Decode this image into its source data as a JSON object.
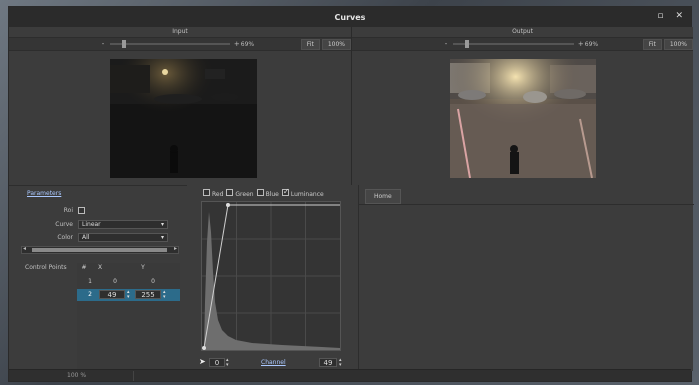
{
  "window": {
    "title": "Curves"
  },
  "input": {
    "header": "Input",
    "zoom_minus": "-",
    "zoom_plus": "+",
    "zoom_value": "69%",
    "fit_label": "Fit",
    "hundred_label": "100%"
  },
  "output": {
    "header": "Output",
    "zoom_minus": "-",
    "zoom_plus": "+",
    "zoom_value": "69%",
    "fit_label": "Fit",
    "hundred_label": "100%"
  },
  "parameters": {
    "title": "Parameters",
    "roi_label": "Roi",
    "curve_label": "Curve",
    "curve_value": "Linear",
    "color_label": "Color",
    "color_value": "All",
    "control_points_label": "Control Points",
    "table": {
      "headers": [
        "#",
        "X",
        "Y"
      ],
      "rows": [
        {
          "n": "1",
          "x": "0",
          "y": "0"
        },
        {
          "n": "2",
          "x": "49",
          "y": "255"
        }
      ]
    }
  },
  "curve": {
    "channels": [
      "Red",
      "Green",
      "Blue",
      "Luminance"
    ],
    "min_value": "0",
    "max_value": "49",
    "channel_label": "Channel"
  },
  "home": {
    "tab_label": "Home"
  },
  "status": {
    "zoom": "100 %"
  },
  "colors": {
    "accent": "#2c6b8a",
    "background": "#3c3c3c",
    "titlebar": "#2b2b2b"
  }
}
